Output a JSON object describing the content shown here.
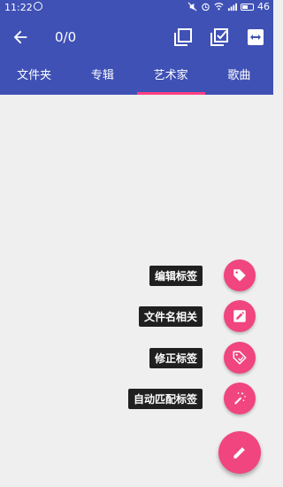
{
  "status_bar": {
    "time": "11:22",
    "battery": "46"
  },
  "toolbar": {
    "selection_count": "0/0"
  },
  "tabs": [
    {
      "label": "文件夹"
    },
    {
      "label": "专辑"
    },
    {
      "label": "艺术家",
      "active": true
    },
    {
      "label": "歌曲"
    }
  ],
  "fab_menu": [
    {
      "label": "编辑标签",
      "icon": "tag-icon"
    },
    {
      "label": "文件名相关",
      "icon": "edit-box-icon"
    },
    {
      "label": "修正标签",
      "icon": "tag-fix-icon"
    },
    {
      "label": "自动匹配标签",
      "icon": "magic-wand-icon"
    }
  ],
  "colors": {
    "primary": "#3f51b5",
    "accent": "#ff4081",
    "fab": "#f0457f",
    "background": "#efefef"
  }
}
